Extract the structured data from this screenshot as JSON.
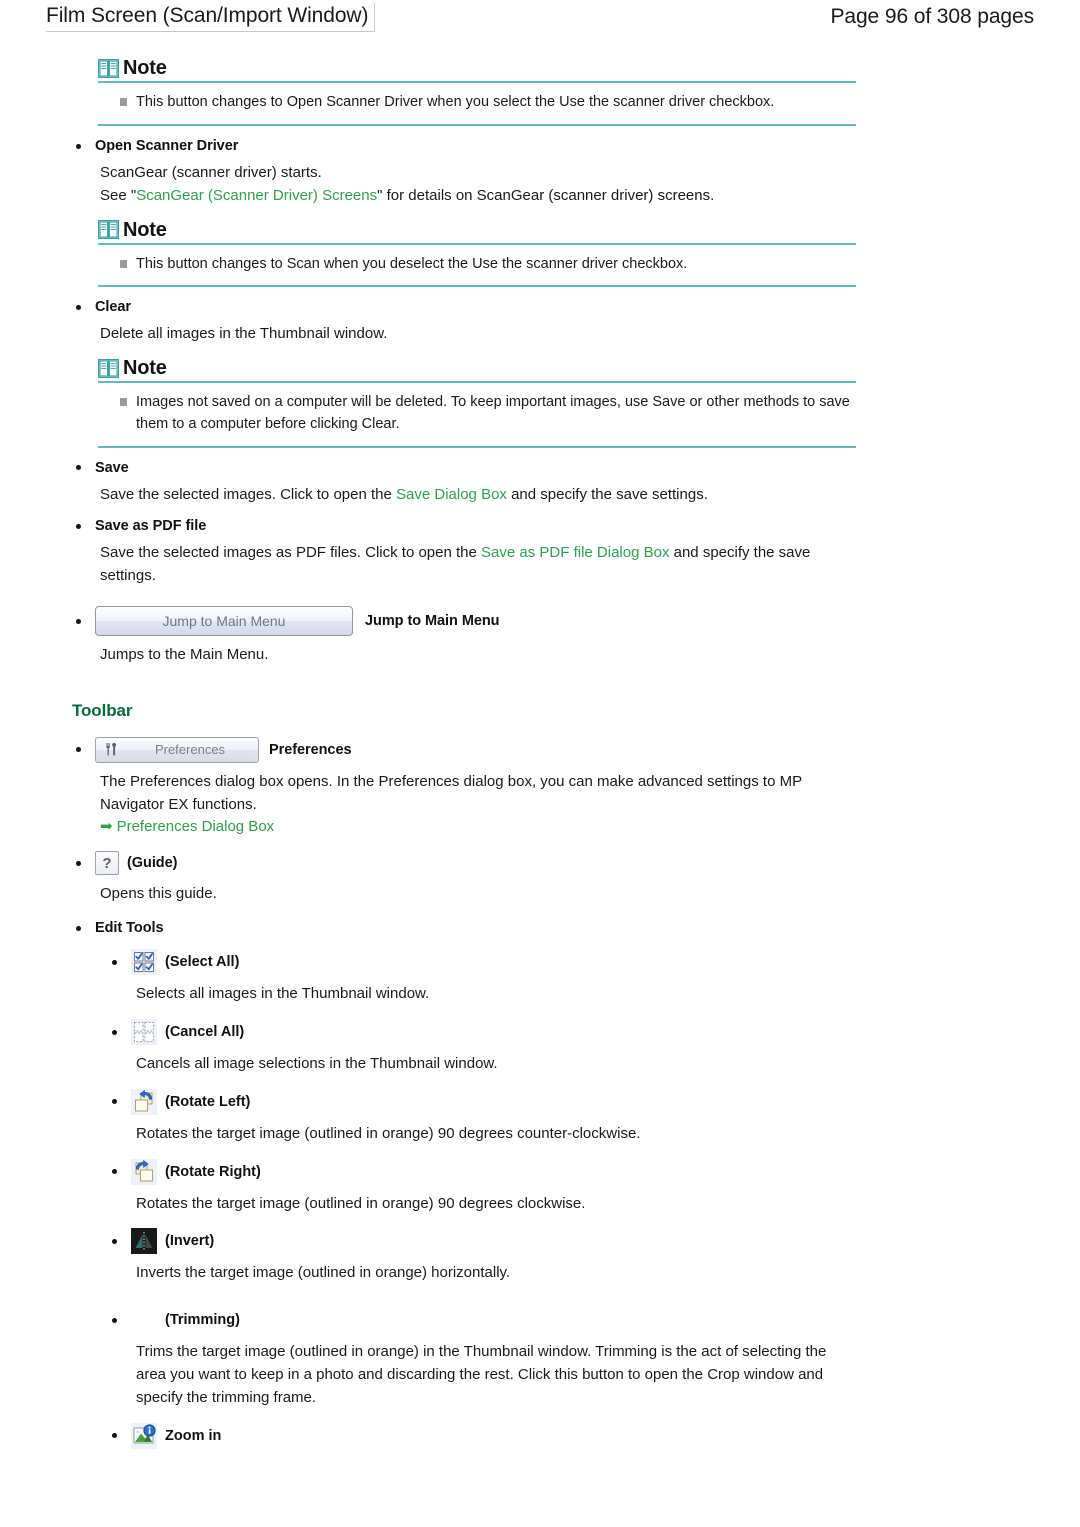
{
  "header": {
    "title": "Film Screen (Scan/Import Window)",
    "page_indicator": "Page 96 of 308 pages"
  },
  "colors": {
    "note_rule": "#63b8b8",
    "link_green": "#2f9e4f",
    "heading_green": "#0a6b3d",
    "text": "#1a1a1a"
  },
  "notes": {
    "label": "Note",
    "note1_text": "This button changes to Open Scanner Driver when you select the Use the scanner driver checkbox.",
    "note2_text": "This button changes to Scan when you deselect the Use the scanner driver checkbox.",
    "note3_text": "Images not saved on a computer will be deleted. To keep important images, use Save or other methods to save them to a computer before clicking Clear."
  },
  "entries": {
    "open_scanner_driver": {
      "term": "Open Scanner Driver",
      "line1": "ScanGear (scanner driver) starts.",
      "line2_pre": "See \"",
      "line2_link": "ScanGear (Scanner Driver) Screens",
      "line2_post": "\" for details on ScanGear (scanner driver) screens."
    },
    "clear": {
      "term": "Clear",
      "desc": "Delete all images in the Thumbnail window."
    },
    "save": {
      "term": "Save",
      "desc_pre": "Save the selected images. Click to open the ",
      "desc_link": "Save Dialog Box",
      "desc_post": " and specify the save settings."
    },
    "save_as_pdf": {
      "term": "Save as PDF file",
      "desc_pre": "Save the selected images as PDF files. Click to open the ",
      "desc_link": "Save as PDF file Dialog Box",
      "desc_post": " and specify the save settings."
    },
    "jump_to_main_menu": {
      "button_label": "Jump to Main Menu",
      "term": "Jump to Main Menu",
      "desc": "Jumps to the Main Menu."
    }
  },
  "toolbar": {
    "heading": "Toolbar",
    "preferences": {
      "button_label": "Preferences",
      "term": "Preferences",
      "desc": "The Preferences dialog box opens. In the Preferences dialog box, you can make advanced settings to MP Navigator EX functions.",
      "link": "Preferences Dialog Box",
      "arrow_glyph": "➡"
    },
    "guide": {
      "button_label": "?",
      "term": "(Guide)",
      "desc": "Opens this guide."
    },
    "edit_tools": {
      "term": "Edit Tools",
      "items": [
        {
          "icon": "select-all-icon",
          "term": "(Select All)",
          "desc": "Selects all images in the Thumbnail window."
        },
        {
          "icon": "cancel-all-icon",
          "term": "(Cancel All)",
          "desc": "Cancels all image selections in the Thumbnail window."
        },
        {
          "icon": "rotate-left-icon",
          "term": "(Rotate Left)",
          "desc": "Rotates the target image (outlined in orange) 90 degrees counter-clockwise."
        },
        {
          "icon": "rotate-right-icon",
          "term": "(Rotate Right)",
          "desc": "Rotates the target image (outlined in orange) 90 degrees clockwise."
        },
        {
          "icon": "invert-icon",
          "term": "(Invert)",
          "desc": "Inverts the target image (outlined in orange) horizontally."
        },
        {
          "icon": "trimming-icon",
          "term": "(Trimming)",
          "desc": "Trims the target image (outlined in orange) in the Thumbnail window. Trimming is the act of selecting the area you want to keep in a photo and discarding the rest. Click this button to open the Crop window and specify the trimming frame."
        },
        {
          "icon": "zoom-in-icon",
          "term": "Zoom in",
          "desc": ""
        }
      ]
    }
  }
}
